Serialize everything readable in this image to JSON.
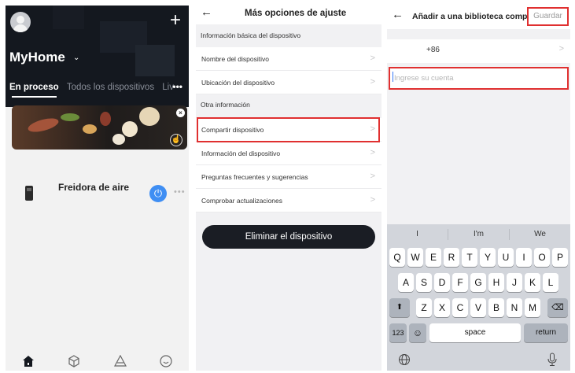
{
  "panel1": {
    "home_title": "MyHome",
    "home_caret": "⌄",
    "plus": "+",
    "tabs": [
      "En proceso",
      "Todos los dispositivos",
      "Liv"
    ],
    "more": "•••",
    "banner_close": "×",
    "banner_hand": "☝",
    "device": {
      "name": "Freidora de aire",
      "power": "⏻",
      "more": "•••"
    },
    "accent": "#3f8ef3"
  },
  "panel2": {
    "title": "Más opciones de ajuste",
    "back": "←",
    "section_basic": "Información básica del dispositivo",
    "basic_items": [
      "Nombre del dispositivo",
      "Ubicación del dispositivo"
    ],
    "section_other": "Otra información",
    "other_items": [
      "Compartir dispositivo",
      "Información del dispositivo",
      "Preguntas frecuentes y sugerencias",
      "Comprobar actualizaciones"
    ],
    "chevron": ">",
    "delete_label": "Eliminar el dispositivo"
  },
  "panel3": {
    "back": "←",
    "title": "Añadir a una biblioteca comp...",
    "save": "Guardar",
    "phone_code": "+86",
    "chevron": ">",
    "account_placeholder": "Ingrese su cuenta",
    "keyboard": {
      "suggestions": [
        "I",
        "I'm",
        "We"
      ],
      "row1": [
        "Q",
        "W",
        "E",
        "R",
        "T",
        "Y",
        "U",
        "I",
        "O",
        "P"
      ],
      "row2": [
        "A",
        "S",
        "D",
        "F",
        "G",
        "H",
        "J",
        "K",
        "L"
      ],
      "row3": [
        "Z",
        "X",
        "C",
        "V",
        "B",
        "N",
        "M"
      ],
      "shift": "⬆",
      "backspace": "⌫",
      "numbers": "123",
      "emoji": "☺",
      "space": "space",
      "return": "return",
      "globe": "🌐",
      "mic": "🎙"
    }
  },
  "highlight_color": "#e03030"
}
